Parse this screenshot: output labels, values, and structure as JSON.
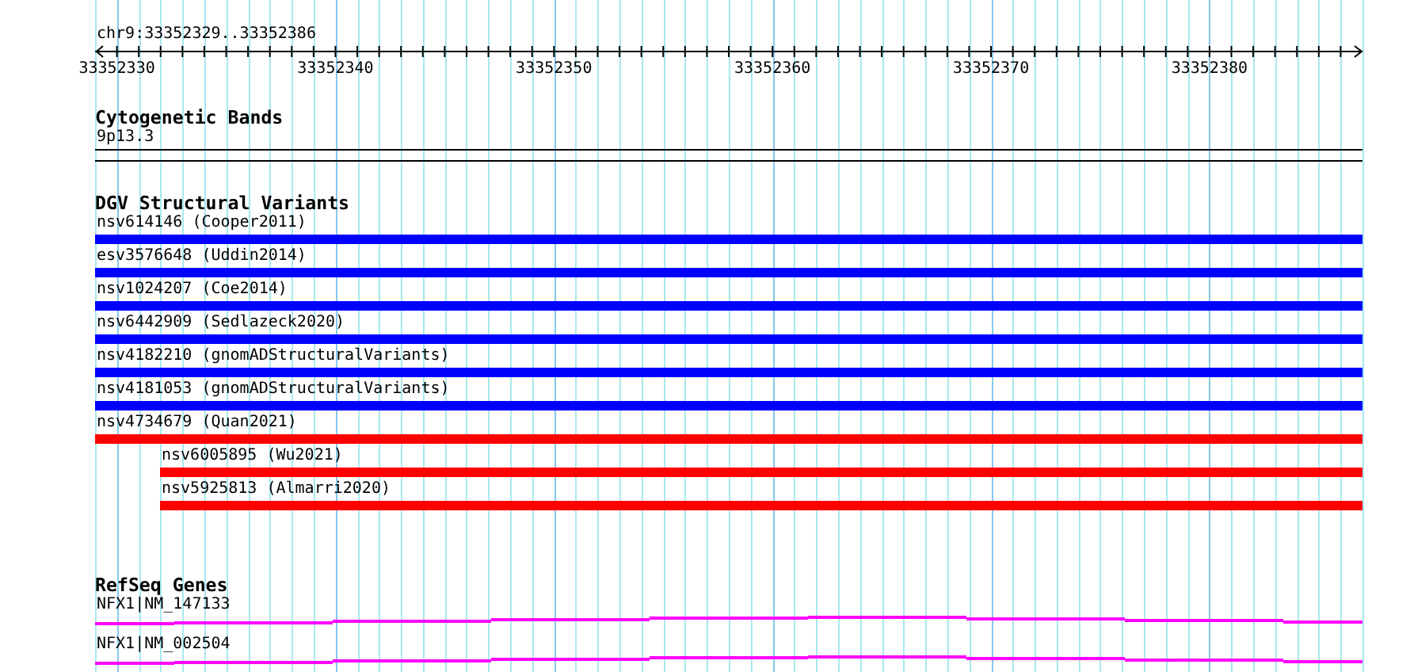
{
  "ruler": {
    "location": "chr9:33352329..33352386",
    "tick_labels": [
      "33352330",
      "33352340",
      "33352350",
      "33352360",
      "33352370",
      "33352380"
    ]
  },
  "tracks": [
    {
      "kind": "bands",
      "title": "Cytogenetic Bands",
      "features": [
        {
          "name": "9p13.3"
        }
      ]
    },
    {
      "kind": "variants",
      "title": "DGV Structural Variants",
      "features": [
        {
          "name": "nsv614146 (Cooper2011)",
          "color": "#0000ff",
          "kind": "full"
        },
        {
          "name": "esv3576648 (Uddin2014)",
          "color": "#0000ff",
          "kind": "full"
        },
        {
          "name": "nsv1024207 (Coe2014)",
          "color": "#0000ff",
          "kind": "full"
        },
        {
          "name": "nsv6442909 (Sedlazeck2020)",
          "color": "#0000ff",
          "kind": "full"
        },
        {
          "name": "nsv4182210 (gnomADStructuralVariants)",
          "color": "#0000ff",
          "kind": "full"
        },
        {
          "name": "nsv4181053 (gnomADStructuralVariants)",
          "color": "#0000ff",
          "kind": "full"
        },
        {
          "name": "nsv4734679 (Quan2021)",
          "color": "#ff0000",
          "kind": "full"
        },
        {
          "name": "nsv6005895 (Wu2021)",
          "color": "#ff0000",
          "kind": "inset"
        },
        {
          "name": "nsv5925813 (Almarri2020)",
          "color": "#ff0000",
          "kind": "inset"
        }
      ]
    },
    {
      "kind": "genes",
      "title": "RefSeq Genes",
      "features": [
        {
          "name": "NFX1|NM_147133"
        },
        {
          "name": "NFX1|NM_002504"
        }
      ]
    }
  ]
}
